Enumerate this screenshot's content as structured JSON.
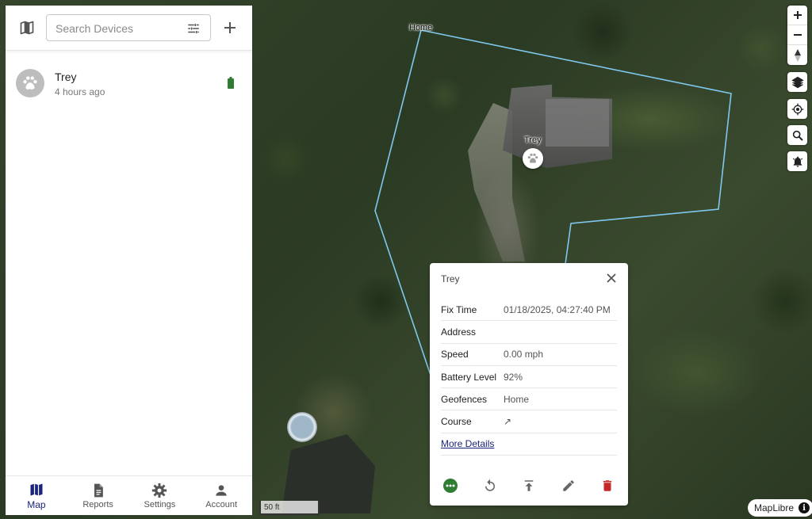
{
  "search": {
    "placeholder": "Search Devices"
  },
  "devices": [
    {
      "name": "Trey",
      "last_seen": "4 hours ago",
      "battery_color": "#2e7d32"
    }
  ],
  "nav": [
    {
      "label": "Map",
      "icon": "map-icon",
      "active": true
    },
    {
      "label": "Reports",
      "icon": "description-icon"
    },
    {
      "label": "Settings",
      "icon": "gear-icon"
    },
    {
      "label": "Account",
      "icon": "person-icon"
    }
  ],
  "map": {
    "geofence_label": "Home",
    "marker_label": "Trey",
    "scale_label": "50 ft",
    "attribution": "MapLibre",
    "geofence_color": "#7ec8ee",
    "controls": [
      "zoom-in-icon",
      "zoom-out-icon",
      "compass-icon",
      "layers-icon",
      "my-location-icon",
      "search-icon",
      "notifications-icon"
    ]
  },
  "popup": {
    "title": "Trey",
    "rows": [
      {
        "key": "Fix Time",
        "value": "01/18/2025, 04:27:40 PM"
      },
      {
        "key": "Address",
        "value": ""
      },
      {
        "key": "Speed",
        "value": "0.00 mph"
      },
      {
        "key": "Battery Level",
        "value": "92%"
      },
      {
        "key": "Geofences",
        "value": "Home"
      },
      {
        "key": "Course",
        "value": "↗"
      }
    ],
    "more_details": "More Details",
    "actions": [
      "more-icon",
      "replay-icon",
      "upload-icon",
      "edit-icon",
      "delete-icon"
    ],
    "colors": {
      "more": "#2e7d32",
      "delete": "#c62828",
      "neutral": "#666666"
    }
  }
}
